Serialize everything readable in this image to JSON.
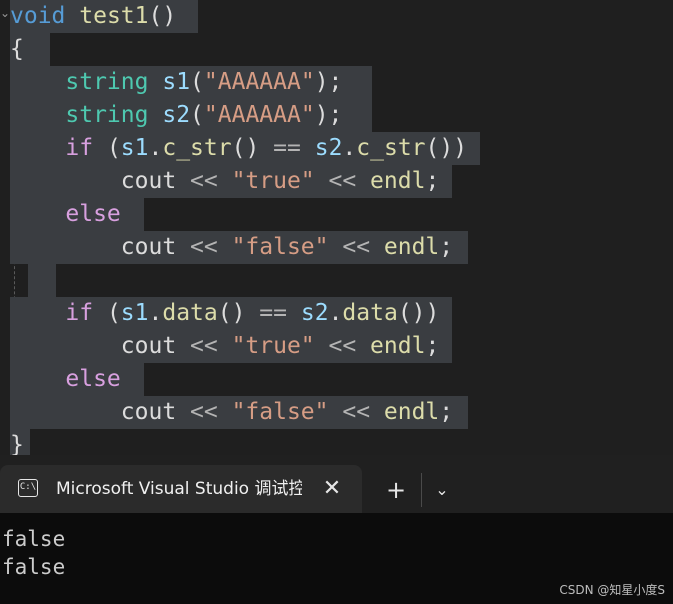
{
  "editor": {
    "lines": [
      [
        {
          "t": "void",
          "c": "kw"
        },
        {
          "t": " ",
          "c": "plain"
        },
        {
          "t": "test1",
          "c": "fn"
        },
        {
          "t": "()",
          "c": "plain"
        }
      ],
      [
        {
          "t": "{",
          "c": "plain"
        }
      ],
      [
        {
          "t": "    ",
          "c": "plain"
        },
        {
          "t": "string",
          "c": "type"
        },
        {
          "t": " ",
          "c": "plain"
        },
        {
          "t": "s1",
          "c": "var"
        },
        {
          "t": "(",
          "c": "plain"
        },
        {
          "t": "\"AAAAAA\"",
          "c": "str"
        },
        {
          "t": ");",
          "c": "plain"
        }
      ],
      [
        {
          "t": "    ",
          "c": "plain"
        },
        {
          "t": "string",
          "c": "type"
        },
        {
          "t": " ",
          "c": "plain"
        },
        {
          "t": "s2",
          "c": "var"
        },
        {
          "t": "(",
          "c": "plain"
        },
        {
          "t": "\"AAAAAA\"",
          "c": "str"
        },
        {
          "t": ");",
          "c": "plain"
        }
      ],
      [
        {
          "t": "    ",
          "c": "plain"
        },
        {
          "t": "if",
          "c": "ctl"
        },
        {
          "t": " (",
          "c": "plain"
        },
        {
          "t": "s1",
          "c": "var"
        },
        {
          "t": ".",
          "c": "plain"
        },
        {
          "t": "c_str",
          "c": "fn"
        },
        {
          "t": "() ",
          "c": "plain"
        },
        {
          "t": "==",
          "c": "op"
        },
        {
          "t": " ",
          "c": "plain"
        },
        {
          "t": "s2",
          "c": "var"
        },
        {
          "t": ".",
          "c": "plain"
        },
        {
          "t": "c_str",
          "c": "fn"
        },
        {
          "t": "())",
          "c": "plain"
        }
      ],
      [
        {
          "t": "        ",
          "c": "plain"
        },
        {
          "t": "cout",
          "c": "plain"
        },
        {
          "t": " << ",
          "c": "op"
        },
        {
          "t": "\"true\"",
          "c": "str"
        },
        {
          "t": " << ",
          "c": "op"
        },
        {
          "t": "endl",
          "c": "fn"
        },
        {
          "t": ";",
          "c": "plain"
        }
      ],
      [
        {
          "t": "    ",
          "c": "plain"
        },
        {
          "t": "else",
          "c": "ctl"
        }
      ],
      [
        {
          "t": "        ",
          "c": "plain"
        },
        {
          "t": "cout",
          "c": "plain"
        },
        {
          "t": " << ",
          "c": "op"
        },
        {
          "t": "\"false\"",
          "c": "str"
        },
        {
          "t": " << ",
          "c": "op"
        },
        {
          "t": "endl",
          "c": "fn"
        },
        {
          "t": ";",
          "c": "plain"
        }
      ],
      [],
      [
        {
          "t": "    ",
          "c": "plain"
        },
        {
          "t": "if",
          "c": "ctl"
        },
        {
          "t": " (",
          "c": "plain"
        },
        {
          "t": "s1",
          "c": "var"
        },
        {
          "t": ".",
          "c": "plain"
        },
        {
          "t": "data",
          "c": "fn"
        },
        {
          "t": "() ",
          "c": "plain"
        },
        {
          "t": "==",
          "c": "op"
        },
        {
          "t": " ",
          "c": "plain"
        },
        {
          "t": "s2",
          "c": "var"
        },
        {
          "t": ".",
          "c": "plain"
        },
        {
          "t": "data",
          "c": "fn"
        },
        {
          "t": "())",
          "c": "plain"
        }
      ],
      [
        {
          "t": "        ",
          "c": "plain"
        },
        {
          "t": "cout",
          "c": "plain"
        },
        {
          "t": " << ",
          "c": "op"
        },
        {
          "t": "\"true\"",
          "c": "str"
        },
        {
          "t": " << ",
          "c": "op"
        },
        {
          "t": "endl",
          "c": "fn"
        },
        {
          "t": ";",
          "c": "plain"
        }
      ],
      [
        {
          "t": "    ",
          "c": "plain"
        },
        {
          "t": "else",
          "c": "ctl"
        }
      ],
      [
        {
          "t": "        ",
          "c": "plain"
        },
        {
          "t": "cout",
          "c": "plain"
        },
        {
          "t": " << ",
          "c": "op"
        },
        {
          "t": "\"false\"",
          "c": "str"
        },
        {
          "t": " << ",
          "c": "op"
        },
        {
          "t": "endl",
          "c": "fn"
        },
        {
          "t": ";",
          "c": "plain"
        }
      ],
      [
        {
          "t": "}",
          "c": "plain"
        }
      ]
    ]
  },
  "terminal": {
    "tab_title": "Microsoft Visual Studio 调试控制台",
    "tab_icon_text": "C:\\",
    "close_glyph": "✕",
    "new_tab_glyph": "+",
    "dropdown_glyph": "⌄",
    "output": [
      "false",
      "false"
    ]
  },
  "watermark": "CSDN @知星小度S",
  "icons": {
    "tab_icon": "terminal-icon",
    "close": "close-icon",
    "new_tab": "plus-icon",
    "dropdown": "chevron-down-icon"
  }
}
